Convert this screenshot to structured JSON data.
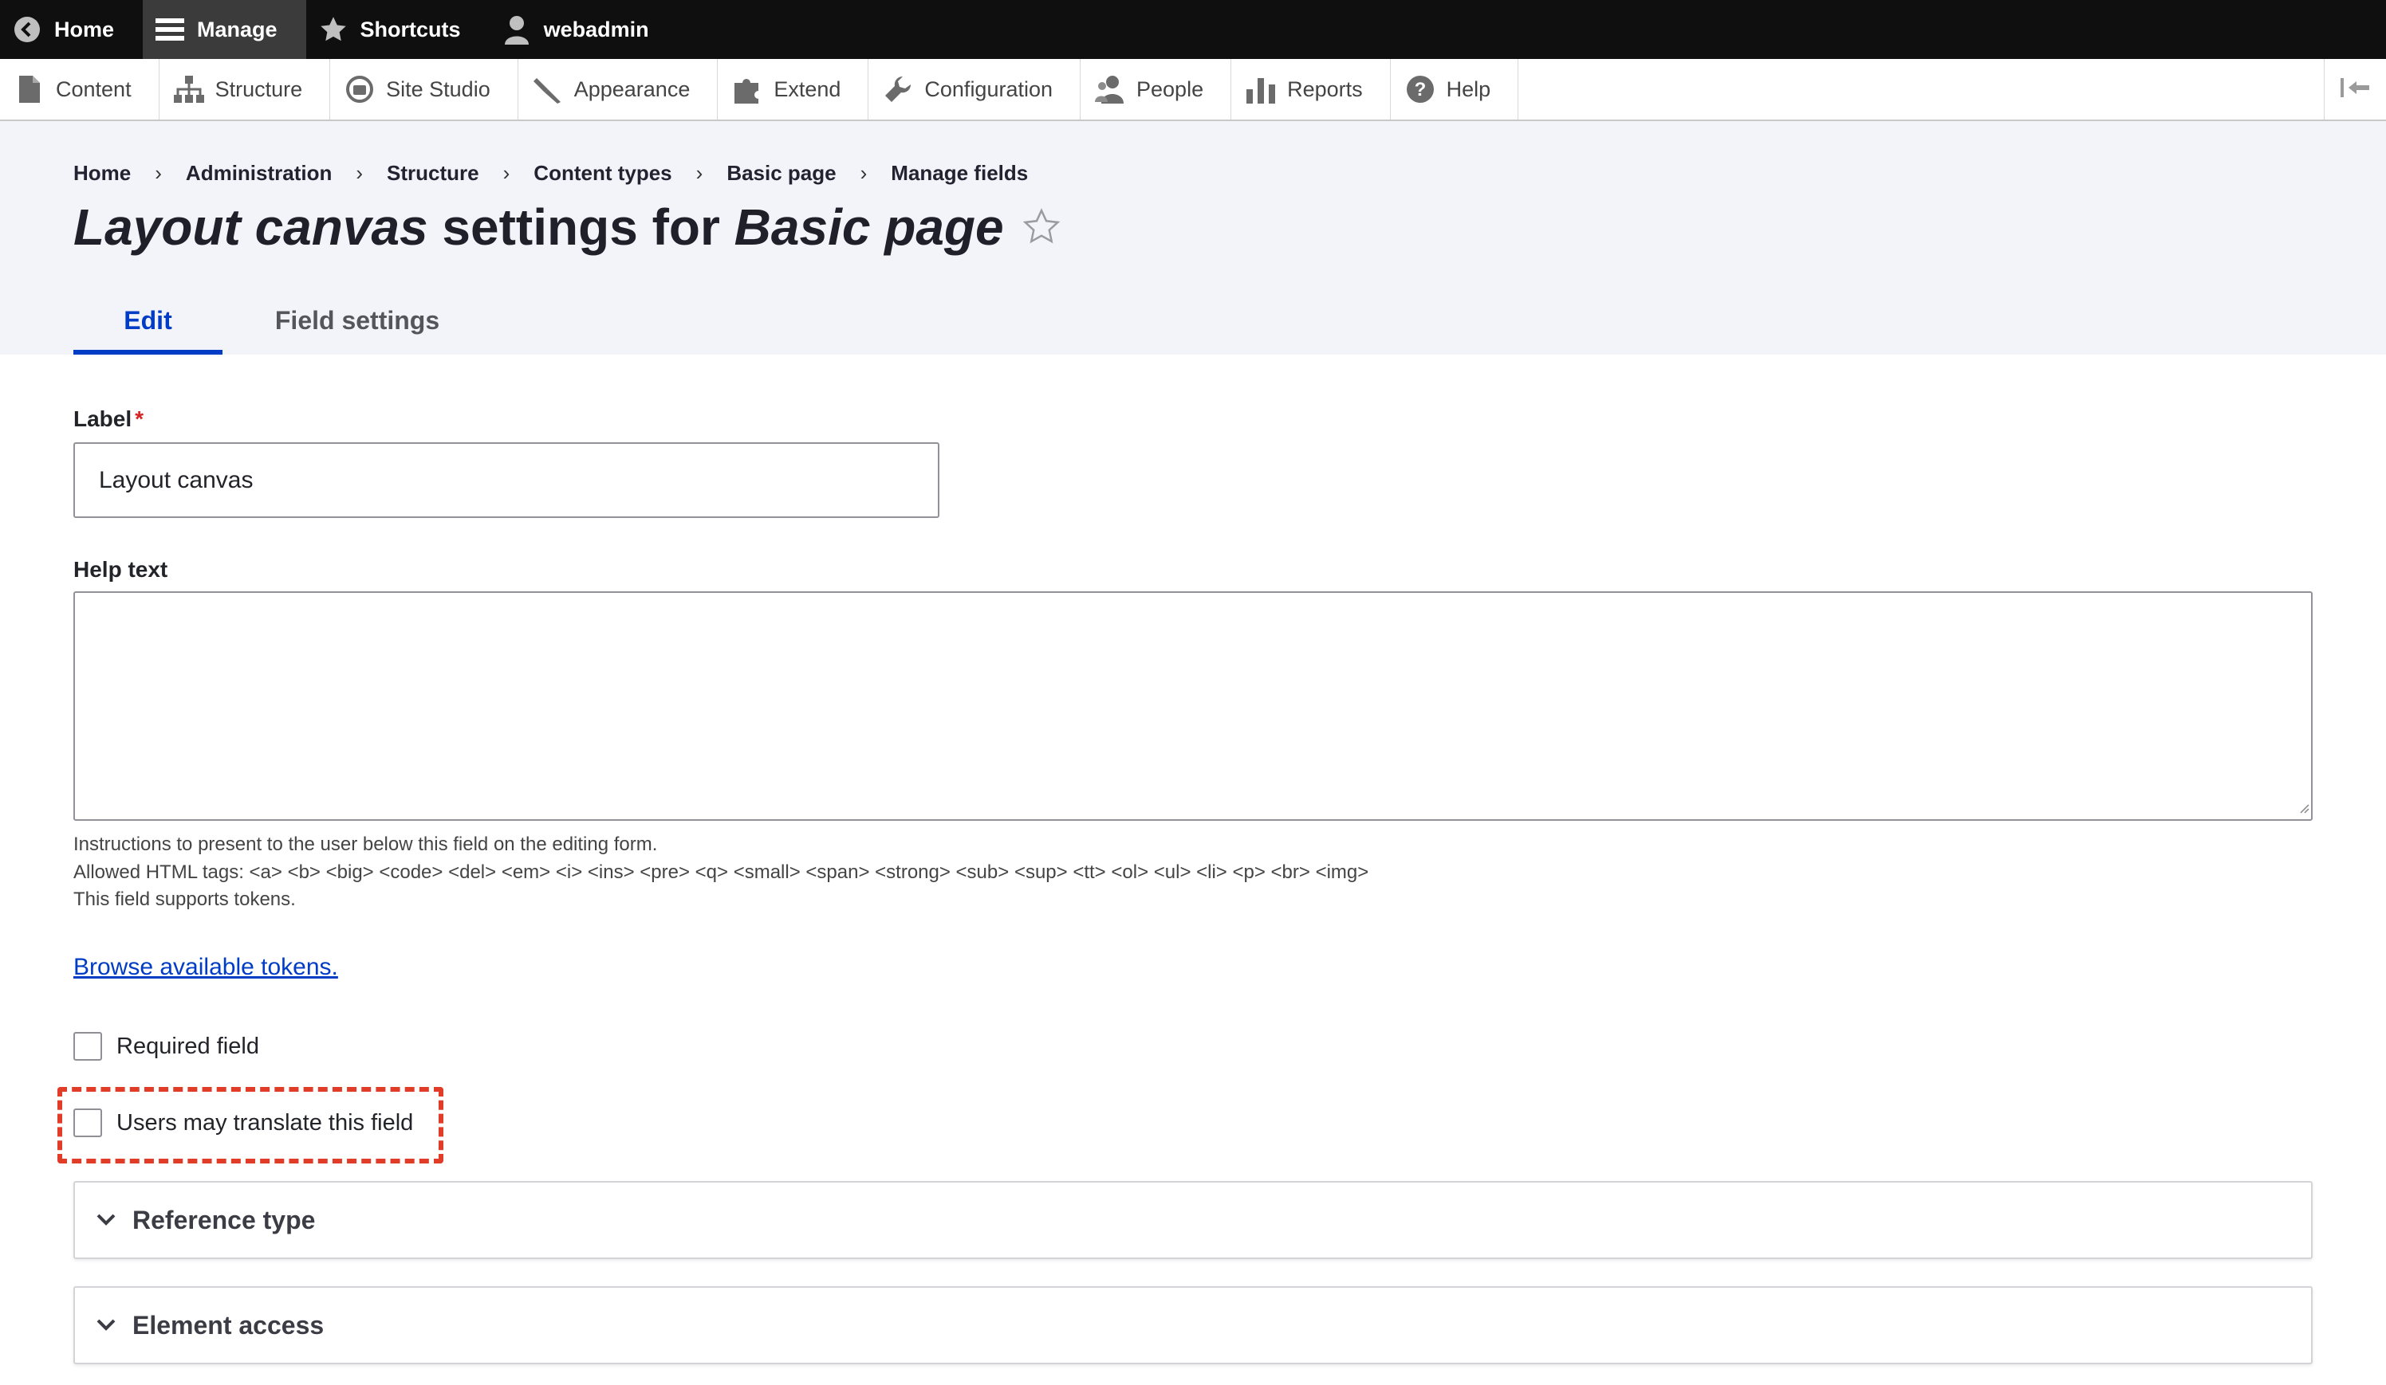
{
  "toolbar": {
    "items": [
      {
        "label": "Home",
        "icon": "back-circle-icon"
      },
      {
        "label": "Manage",
        "icon": "hamburger-icon"
      },
      {
        "label": "Shortcuts",
        "icon": "star-icon"
      },
      {
        "label": "webadmin",
        "icon": "user-icon"
      }
    ]
  },
  "tray": {
    "items": [
      {
        "label": "Content",
        "icon": "document-icon"
      },
      {
        "label": "Structure",
        "icon": "sitemap-icon"
      },
      {
        "label": "Site Studio",
        "icon": "site-studio-icon"
      },
      {
        "label": "Appearance",
        "icon": "paintbrush-icon"
      },
      {
        "label": "Extend",
        "icon": "puzzle-icon"
      },
      {
        "label": "Configuration",
        "icon": "wrench-icon"
      },
      {
        "label": "People",
        "icon": "people-icon"
      },
      {
        "label": "Reports",
        "icon": "bar-chart-icon"
      },
      {
        "label": "Help",
        "icon": "help-icon"
      }
    ]
  },
  "breadcrumb": [
    "Home",
    "Administration",
    "Structure",
    "Content types",
    "Basic page",
    "Manage fields"
  ],
  "title": {
    "part1": "Layout canvas",
    "part2": " settings for ",
    "part3": "Basic page"
  },
  "tabs": [
    {
      "label": "Edit",
      "active": true
    },
    {
      "label": "Field settings",
      "active": false
    }
  ],
  "form": {
    "label_label": "Label",
    "required_marker": "*",
    "label_value": "Layout canvas",
    "help_label": "Help text",
    "help_value": "",
    "help_desc": [
      "Instructions to present to the user below this field on the editing form.",
      "Allowed HTML tags: <a> <b> <big> <code> <del> <em> <i> <ins> <pre> <q> <small> <span> <strong> <sub> <sup> <tt> <ol> <ul> <li> <p> <br> <img>",
      "This field supports tokens."
    ],
    "tokens_link": "Browse available tokens.",
    "required_checkbox": {
      "label": "Required field",
      "checked": false
    },
    "translate_checkbox": {
      "label": "Users may translate this field",
      "checked": false
    },
    "sections": [
      "Reference type",
      "Element access"
    ]
  },
  "colors": {
    "accent": "#003cc5",
    "highlight": "#e03c28",
    "required": "#d72222"
  }
}
